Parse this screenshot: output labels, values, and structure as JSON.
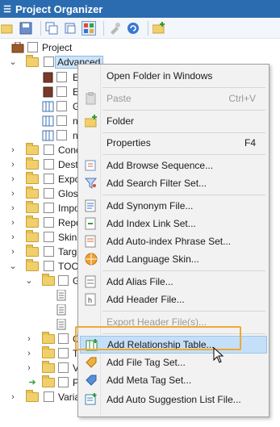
{
  "window": {
    "title": "Project Organizer"
  },
  "tree": {
    "project_label": "Project",
    "advanced_label": "Advanced",
    "child_initials": [
      "E",
      "E",
      "G",
      "n",
      "n"
    ],
    "folders": [
      "Conc",
      "Desti",
      "Expo",
      "Gloss",
      "Impo",
      "Repo",
      "Skins",
      "Targe",
      "TOCs"
    ],
    "tocs_child": "G",
    "lower_children": [
      "C",
      "T",
      "V",
      "P"
    ],
    "variables_label": "Varia"
  },
  "context_menu": {
    "items": [
      {
        "label": "Open Folder in Windows",
        "shortcut": "",
        "icon": "none-icon",
        "enabled": true
      },
      {
        "label": "Paste",
        "shortcut": "Ctrl+V",
        "icon": "paste-icon",
        "enabled": false
      },
      {
        "label": "Folder",
        "shortcut": "",
        "icon": "new-folder-icon",
        "enabled": true
      },
      {
        "label": "Properties",
        "shortcut": "F4",
        "icon": "none-icon",
        "enabled": true
      },
      {
        "label": "Add Browse Sequence...",
        "shortcut": "",
        "icon": "browse-sequence-icon",
        "enabled": true
      },
      {
        "label": "Add Search Filter Set...",
        "shortcut": "",
        "icon": "search-filter-icon",
        "enabled": true
      },
      {
        "label": "Add Synonym File...",
        "shortcut": "",
        "icon": "synonym-icon",
        "enabled": true
      },
      {
        "label": "Add Index Link Set...",
        "shortcut": "",
        "icon": "index-link-icon",
        "enabled": true
      },
      {
        "label": "Add Auto-index Phrase Set...",
        "shortcut": "",
        "icon": "auto-index-icon",
        "enabled": true
      },
      {
        "label": "Add Language Skin...",
        "shortcut": "",
        "icon": "language-skin-icon",
        "enabled": true
      },
      {
        "label": "Add Alias File...",
        "shortcut": "",
        "icon": "alias-icon",
        "enabled": true
      },
      {
        "label": "Add Header File...",
        "shortcut": "",
        "icon": "header-file-icon",
        "enabled": true
      },
      {
        "label": "Export Header File(s)...",
        "shortcut": "",
        "icon": "none-icon",
        "enabled": false
      },
      {
        "label": "Add Relationship Table...",
        "shortcut": "",
        "icon": "relationship-table-icon",
        "enabled": true
      },
      {
        "label": "Add File Tag Set...",
        "shortcut": "",
        "icon": "file-tag-icon",
        "enabled": true
      },
      {
        "label": "Add Meta Tag Set...",
        "shortcut": "",
        "icon": "meta-tag-icon",
        "enabled": true
      },
      {
        "label": "Add Auto Suggestion List File...",
        "shortcut": "",
        "icon": "auto-suggestion-icon",
        "enabled": true
      }
    ],
    "highlighted": "Add Relationship Table..."
  },
  "colors": {
    "title_bar": "#2b6cb0",
    "highlight_frame": "#f0a830",
    "hover": "#c5dff8"
  }
}
